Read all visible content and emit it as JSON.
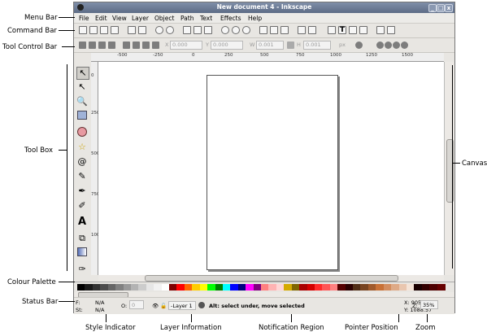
{
  "window": {
    "title": "New document 4 - Inkscape",
    "controls": [
      "_",
      "□",
      "x"
    ]
  },
  "menubar": {
    "items": [
      "File",
      "Edit",
      "View",
      "Layer",
      "Object",
      "Path",
      "Text",
      "Effects",
      "Help"
    ]
  },
  "commandbar": {
    "icons": [
      "new-icon",
      "open-icon",
      "save-icon",
      "print-icon",
      "import-icon",
      "export-icon",
      "undo-icon",
      "redo-icon",
      "copy-icon",
      "cut-icon",
      "paste-icon",
      "zoom-selection-icon",
      "zoom-drawing-icon",
      "zoom-page-icon",
      "duplicate-icon",
      "clone-icon",
      "unlink-clone-icon",
      "group-icon",
      "ungroup-icon",
      "fill-stroke-icon",
      "text-font-icon",
      "xml-editor-icon",
      "align-icon",
      "preferences-icon",
      "document-properties-icon"
    ]
  },
  "toolctl": {
    "x_value": "0.000",
    "y_value": "0.000",
    "w_label": "W",
    "w_value": "0.001",
    "h_label": "H",
    "h_value": "0.001",
    "unit": "px"
  },
  "ruler": {
    "h_ticks": [
      "-500",
      "-250",
      "0",
      "250",
      "500",
      "750",
      "1000",
      "1250",
      "1500"
    ],
    "v_ticks": [
      "0",
      "250",
      "500",
      "750",
      "1000"
    ]
  },
  "statusbar": {
    "fill_label": "F:",
    "fill_value": "N/A",
    "stroke_label": "St:",
    "stroke_value": "N/A",
    "opacity_label": "O:",
    "opacity_value": "0",
    "layer_value": "-Layer 1",
    "notification": "Alt: select under, move selected",
    "pointer_x": "X: 905.71",
    "pointer_y": "Y: 1088.57",
    "zoom_label": "Z:",
    "zoom_value": "35%"
  },
  "annotations": {
    "menu_bar": "Menu Bar",
    "command_bar": "Command Bar",
    "tool_control_bar": "Tool Control Bar",
    "tool_box": "Tool Box",
    "colour_palette": "Colour Palette",
    "status_bar": "Status Bar",
    "canvas": "Canvas",
    "style_indicator": "Style Indicator",
    "layer_information": "Layer Information",
    "notification_region": "Notification Region",
    "pointer_position": "Pointer Position",
    "zoom": "Zoom"
  },
  "palette_colors": [
    "#000000",
    "#1a1a1a",
    "#333333",
    "#4d4d4d",
    "#666666",
    "#808080",
    "#999999",
    "#b3b3b3",
    "#cccccc",
    "#e6e6e6",
    "#f2f2f2",
    "#ffffff",
    "#800000",
    "#ff0000",
    "#ff6600",
    "#ffcc00",
    "#ffff00",
    "#00ff00",
    "#008000",
    "#00ffff",
    "#0000ff",
    "#000080",
    "#ff00ff",
    "#800080",
    "#ff8080",
    "#ffb3b3",
    "#ffd5d5",
    "#d4aa00",
    "#806600",
    "#aa0000",
    "#d40000",
    "#ff2a2a",
    "#ff5555",
    "#ff8080",
    "#550000",
    "#2b0000",
    "#502d16",
    "#784421",
    "#a05a2c",
    "#c87137",
    "#d38d5f",
    "#deaa87",
    "#e9c6af",
    "#f4e3d7",
    "#1a0000",
    "#330000",
    "#4d0000",
    "#660000"
  ]
}
